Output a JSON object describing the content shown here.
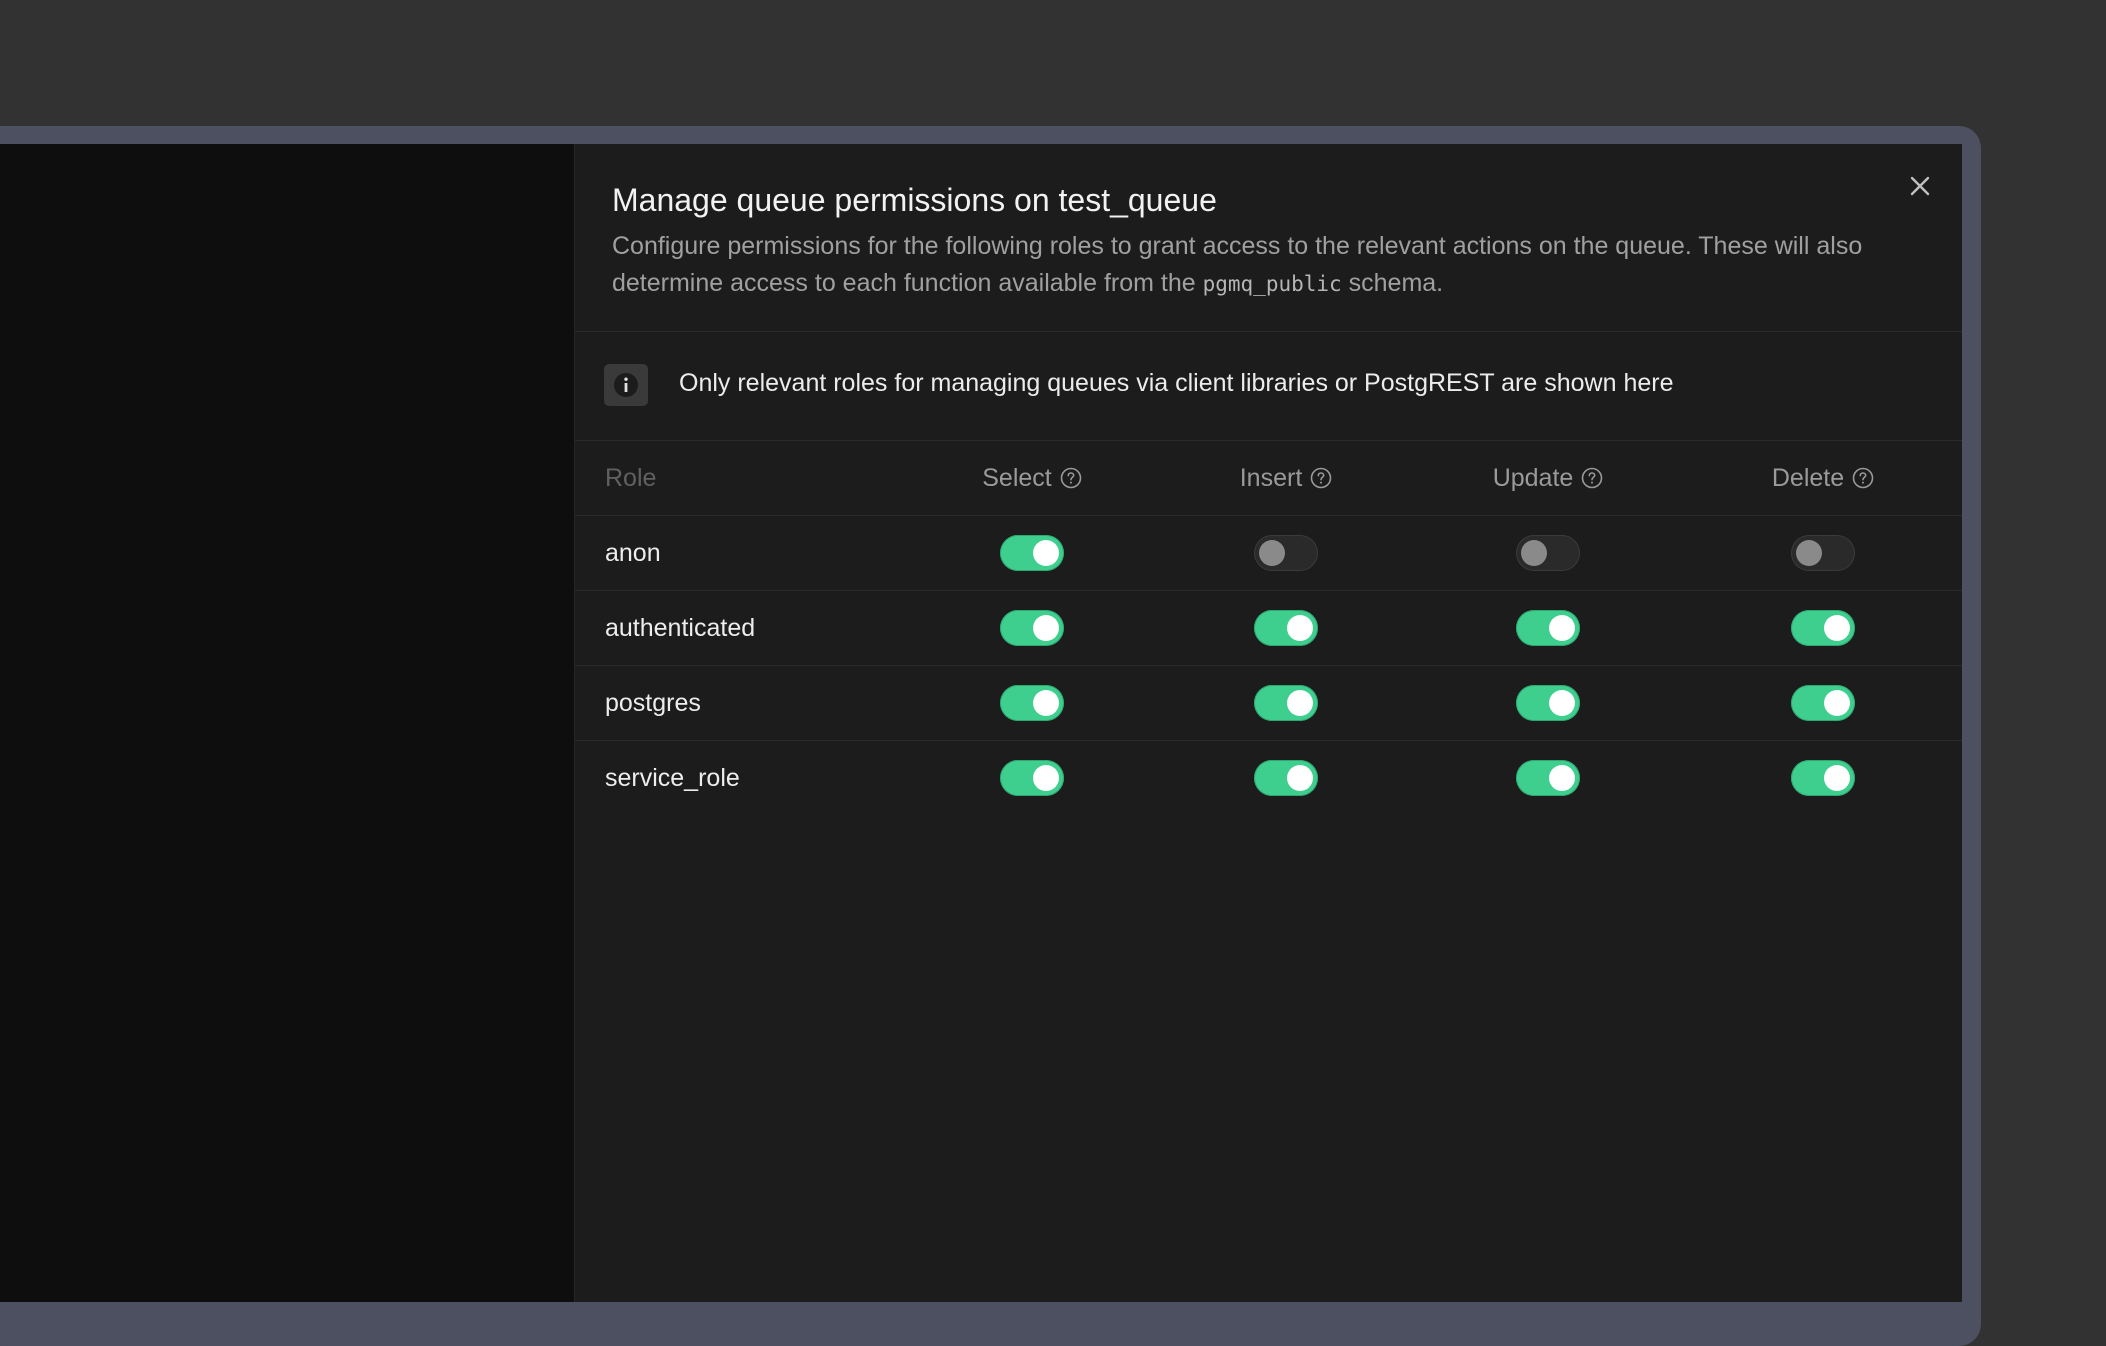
{
  "dialog": {
    "title": "Manage queue permissions on test_queue",
    "description_before": "Configure permissions for the following roles to grant access to the relevant actions on the queue. These will also determine access to each function available from the",
    "description_code": "pgmq_public",
    "description_after": "schema.",
    "close_icon": "close-icon"
  },
  "notice": {
    "icon": "info-icon",
    "text": "Only relevant roles for managing queues via client libraries or PostgREST are shown here"
  },
  "table": {
    "columns": {
      "role": "Role",
      "select": "Select",
      "insert": "Insert",
      "update": "Update",
      "delete": "Delete"
    },
    "rows": [
      {
        "role": "anon",
        "select": true,
        "insert": false,
        "update": false,
        "delete": false
      },
      {
        "role": "authenticated",
        "select": true,
        "insert": true,
        "update": true,
        "delete": true
      },
      {
        "role": "postgres",
        "select": true,
        "insert": true,
        "update": true,
        "delete": true
      },
      {
        "role": "service_role",
        "select": true,
        "insert": true,
        "update": true,
        "delete": true
      }
    ]
  },
  "colors": {
    "toggle_on": "#3ecf8e",
    "toggle_off": "#2a2a2a",
    "panel_bg": "#1c1c1c"
  }
}
